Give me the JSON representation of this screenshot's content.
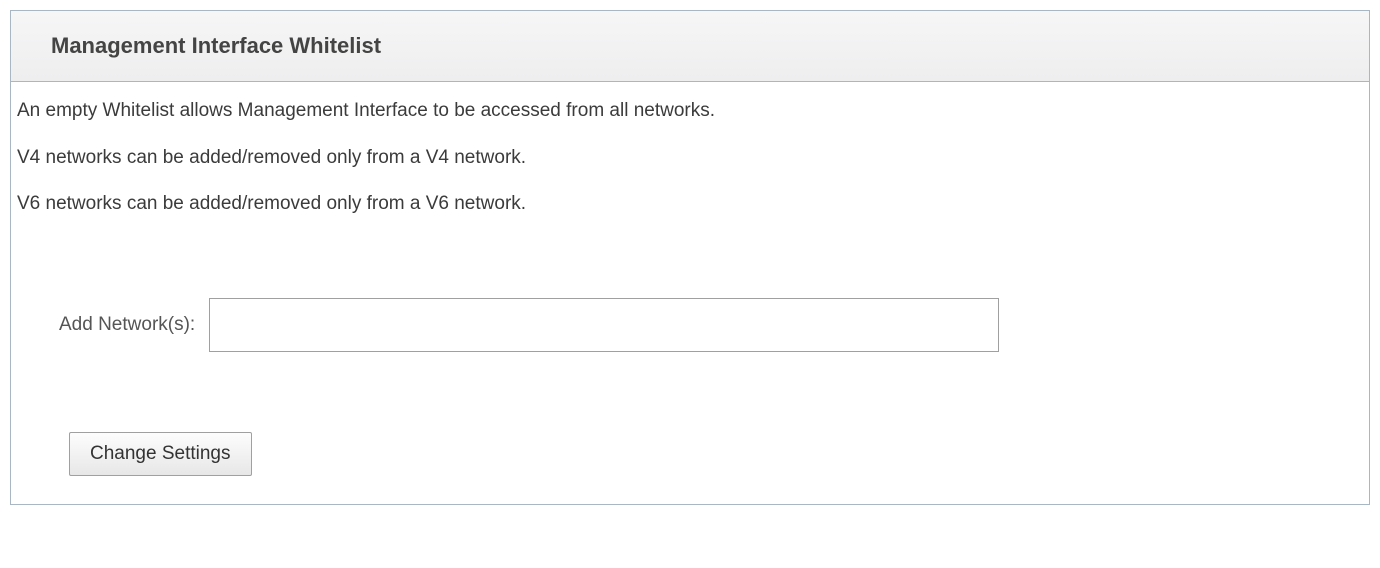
{
  "panel": {
    "title": "Management Interface Whitelist",
    "info": [
      "An empty Whitelist allows Management Interface to be accessed from all networks.",
      "V4 networks can be added/removed only from a V4 network.",
      "V6 networks can be added/removed only from a V6 network."
    ],
    "form": {
      "add_networks_label": "Add Network(s):",
      "add_networks_value": ""
    },
    "submit_label": "Change Settings"
  }
}
